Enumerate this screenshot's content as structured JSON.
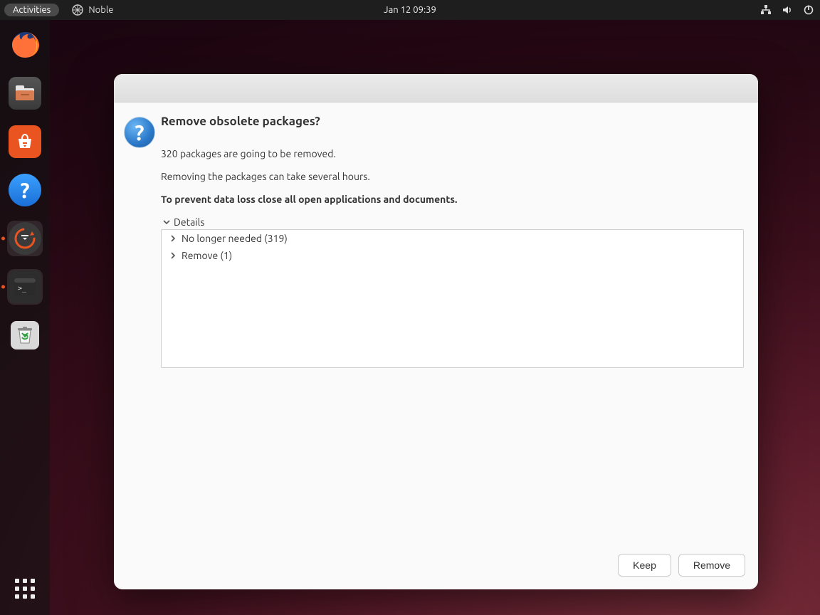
{
  "topbar": {
    "activities_label": "Activities",
    "app_name": "Noble",
    "clock": "Jan 12  09:39"
  },
  "dock": {
    "items": [
      {
        "name": "firefox",
        "active": false
      },
      {
        "name": "files",
        "active": false
      },
      {
        "name": "software",
        "active": false
      },
      {
        "name": "help",
        "active": false
      },
      {
        "name": "software-updater",
        "active": true
      },
      {
        "name": "terminal",
        "active": true
      },
      {
        "name": "trash",
        "active": false
      }
    ]
  },
  "dialog": {
    "heading": "Remove obsolete packages?",
    "line1": "320 packages are going to be removed.",
    "line2": "Removing the packages can take several hours.",
    "warning": "To prevent data loss close all open applications and documents.",
    "details_label": "Details",
    "tree": {
      "items": [
        {
          "label": "No longer needed (319)"
        },
        {
          "label": "Remove (1)"
        }
      ]
    },
    "buttons": {
      "keep": "Keep",
      "remove": "Remove"
    }
  }
}
